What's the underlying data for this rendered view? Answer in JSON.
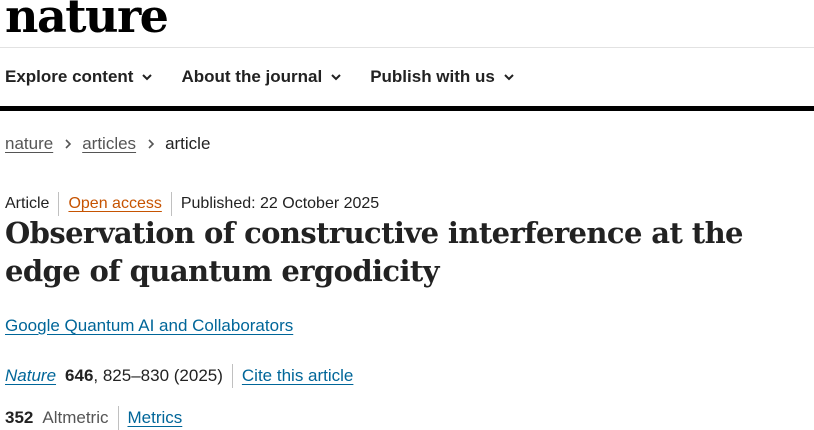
{
  "site": {
    "logo_text": "nature"
  },
  "nav": {
    "items": [
      {
        "label": "Explore content"
      },
      {
        "label": "About the journal"
      },
      {
        "label": "Publish with us"
      }
    ]
  },
  "breadcrumb": {
    "items": [
      {
        "label": "nature"
      },
      {
        "label": "articles"
      },
      {
        "label": "article"
      }
    ]
  },
  "article": {
    "type": "Article",
    "access": "Open access",
    "published": "Published: 22 October 2025",
    "title": "Observation of constructive interference at the edge of quantum ergodicity",
    "authors": "Google Quantum AI and Collaborators",
    "citation": {
      "journal": "Nature",
      "volume": "646",
      "pages_year": ", 825–830 (2025)",
      "cite_label": "Cite this article"
    },
    "metrics": {
      "altmetric_count": "352",
      "altmetric_label": "Altmetric",
      "metrics_label": "Metrics"
    }
  },
  "colors": {
    "link": "#006699",
    "open_access": "#c65301",
    "text": "#222222",
    "nav_rule": "#000000"
  }
}
